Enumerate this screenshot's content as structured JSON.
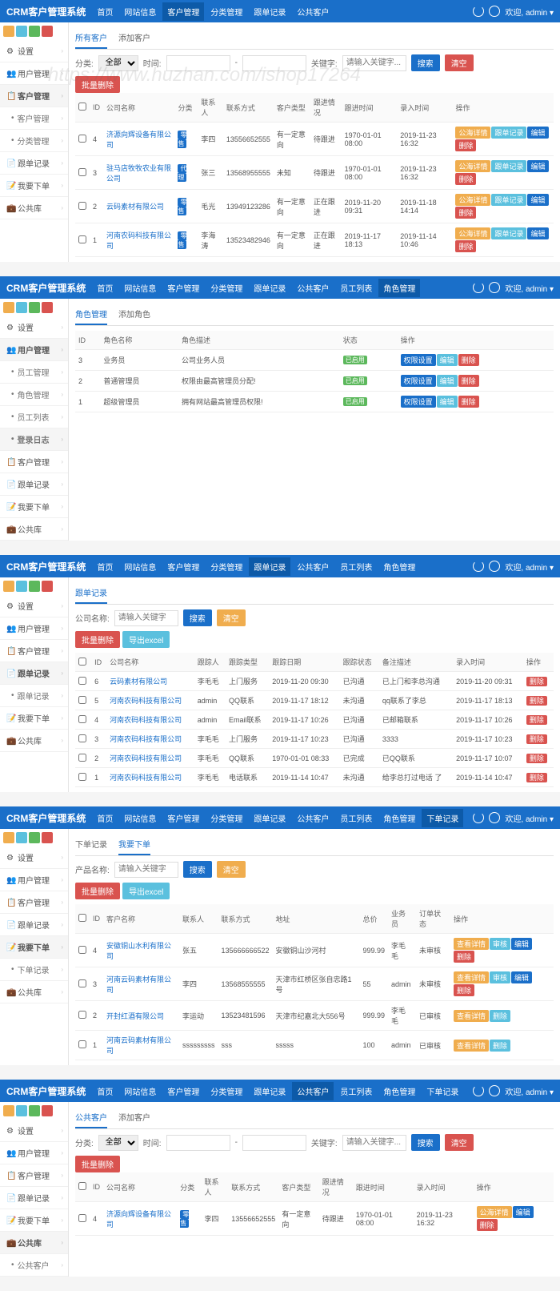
{
  "brand": "CRM客户管理系统",
  "welcome": "欢迎, admin",
  "watermark": "https://www.huzhan.com/ishop17264",
  "nav_items": [
    "首页",
    "网站信息",
    "客户管理",
    "分类管理",
    "跟单记录",
    "公共客户",
    "员工列表",
    "角色管理",
    "下单记录"
  ],
  "p1": {
    "nav_active": 2,
    "sidebar": [
      {
        "label": "设置",
        "icon": "⚙"
      },
      {
        "label": "用户管理",
        "icon": "👥"
      },
      {
        "label": "客户管理",
        "icon": "📋",
        "active": true
      },
      {
        "label": "客户管理",
        "sub": true
      },
      {
        "label": "分类管理",
        "sub": true
      },
      {
        "label": "跟单记录",
        "icon": "📄"
      },
      {
        "label": "我要下单",
        "icon": "📝"
      },
      {
        "label": "公共库",
        "icon": "💼"
      }
    ],
    "tabs": [
      "所有客户",
      "添加客户"
    ],
    "filters": {
      "cat": "分类:",
      "cat_all": "全部",
      "time": "时间:",
      "kw": "关键字:",
      "kw_ph": "请输入关键字...",
      "search": "搜索",
      "clear": "清空"
    },
    "batch_del": "批量删除",
    "cols": [
      "ID",
      "公司名称",
      "分类",
      "联系人",
      "联系方式",
      "客户类型",
      "跟进情况",
      "跟进时间",
      "录入时间",
      "操作"
    ],
    "rows": [
      {
        "id": "4",
        "co": "济源向辉设备有限公司",
        "cat": "零售",
        "contact": "李四",
        "phone": "13556652555",
        "type": "有一定意向",
        "follow": "待跟进",
        "ftime": "1970-01-01 08:00",
        "rtime": "2019-11-23 16:32"
      },
      {
        "id": "3",
        "co": "驻马店牧牧农业有限公司",
        "cat": "代理",
        "contact": "张三",
        "phone": "13568955555",
        "type": "未知",
        "follow": "待跟进",
        "ftime": "1970-01-01 08:00",
        "rtime": "2019-11-23 16:32"
      },
      {
        "id": "2",
        "co": "云码素材有限公司",
        "cat": "零售",
        "contact": "毛光",
        "phone": "13949123286",
        "type": "有一定意向",
        "follow": "正在跟进",
        "ftime": "2019-11-20 09:31",
        "rtime": "2019-11-18 14:14"
      },
      {
        "id": "1",
        "co": "河南农码科技有限公司",
        "cat": "零售",
        "contact": "李海涛",
        "phone": "13523482946",
        "type": "有一定意向",
        "follow": "正在跟进",
        "ftime": "2019-11-17 18:13",
        "rtime": "2019-11-14 10:46"
      }
    ],
    "ops": [
      "公海详情",
      "跟单记录",
      "编辑",
      "删除"
    ]
  },
  "p2": {
    "nav_active": 7,
    "sidebar": [
      {
        "label": "设置",
        "icon": "⚙"
      },
      {
        "label": "用户管理",
        "icon": "👥",
        "active": true
      },
      {
        "label": "员工管理",
        "sub": true
      },
      {
        "label": "角色管理",
        "sub": true
      },
      {
        "label": "员工列表",
        "sub": true
      },
      {
        "label": "登录日志",
        "sub": true,
        "active": true
      },
      {
        "label": "客户管理",
        "icon": "📋"
      },
      {
        "label": "跟单记录",
        "icon": "📄"
      },
      {
        "label": "我要下单",
        "icon": "📝"
      },
      {
        "label": "公共库",
        "icon": "💼"
      }
    ],
    "tabs": [
      "角色管理",
      "添加角色"
    ],
    "cols": [
      "ID",
      "角色名称",
      "角色描述",
      "状态",
      "操作"
    ],
    "rows": [
      {
        "id": "3",
        "name": "业务员",
        "desc": "公司业务人员",
        "status": "已启用"
      },
      {
        "id": "2",
        "name": "普通管理员",
        "desc": "权限由最高管理员分配!",
        "status": "已启用"
      },
      {
        "id": "1",
        "name": "超级管理员",
        "desc": "拥有网站最高管理员权限!",
        "status": "已启用"
      }
    ],
    "ops": [
      "权限设置",
      "编辑",
      "删除"
    ]
  },
  "p3": {
    "nav_active": 4,
    "sidebar": [
      {
        "label": "设置",
        "icon": "⚙"
      },
      {
        "label": "用户管理",
        "icon": "👥"
      },
      {
        "label": "客户管理",
        "icon": "📋"
      },
      {
        "label": "跟单记录",
        "icon": "📄",
        "active": true
      },
      {
        "label": "跟单记录",
        "sub": true
      },
      {
        "label": "我要下单",
        "icon": "📝"
      },
      {
        "label": "公共库",
        "icon": "💼"
      }
    ],
    "tabs": [
      "跟单记录"
    ],
    "search_label": "公司名称:",
    "search_ph": "请输入关键字",
    "btn_search": "搜索",
    "btn_clear": "清空",
    "batch_del": "批量删除",
    "export": "导出excel",
    "cols": [
      "ID",
      "公司名称",
      "跟踪人",
      "跟踪类型",
      "跟踪日期",
      "跟踪状态",
      "备注描述",
      "录入时间",
      "操作"
    ],
    "rows": [
      {
        "id": "6",
        "co": "云码素材有限公司",
        "person": "李毛毛",
        "type": "上门服务",
        "date": "2019-11-20 09:30",
        "status": "已沟通",
        "note": "已上门和李总沟通",
        "rtime": "2019-11-20 09:31"
      },
      {
        "id": "5",
        "co": "河南农码科技有限公司",
        "person": "admin",
        "type": "QQ联系",
        "date": "2019-11-17 18:12",
        "status": "未沟通",
        "note": "qq联系了李总",
        "rtime": "2019-11-17 18:13"
      },
      {
        "id": "4",
        "co": "河南农码科技有限公司",
        "person": "admin",
        "type": "Email联系",
        "date": "2019-11-17 10:26",
        "status": "已沟通",
        "note": "已邮箱联系",
        "rtime": "2019-11-17 10:26"
      },
      {
        "id": "3",
        "co": "河南农码科技有限公司",
        "person": "李毛毛",
        "type": "上门服务",
        "date": "2019-11-17 10:23",
        "status": "已沟通",
        "note": "3333",
        "rtime": "2019-11-17 10:23"
      },
      {
        "id": "2",
        "co": "河南农码科技有限公司",
        "person": "李毛毛",
        "type": "QQ联系",
        "date": "1970-01-01 08:33",
        "status": "已完成",
        "note": "已QQ联系",
        "rtime": "2019-11-17 10:07"
      },
      {
        "id": "1",
        "co": "河南农码科技有限公司",
        "person": "李毛毛",
        "type": "电话联系",
        "date": "2019-11-14 10:47",
        "status": "未沟通",
        "note": "给李总打过电话 了",
        "rtime": "2019-11-14 10:47"
      }
    ],
    "op_del": "删除"
  },
  "p4": {
    "nav_active": 8,
    "sidebar": [
      {
        "label": "设置",
        "icon": "⚙"
      },
      {
        "label": "用户管理",
        "icon": "👥"
      },
      {
        "label": "客户管理",
        "icon": "📋"
      },
      {
        "label": "跟单记录",
        "icon": "📄"
      },
      {
        "label": "我要下单",
        "icon": "📝",
        "active": true
      },
      {
        "label": "下单记录",
        "sub": true
      },
      {
        "label": "公共库",
        "icon": "💼"
      }
    ],
    "tabs": [
      "下单记录",
      "我要下单"
    ],
    "tab_active": 1,
    "search_label": "产品名称:",
    "search_ph": "请输入关键字",
    "btn_search": "搜索",
    "btn_clear": "清空",
    "batch_del": "批量删除",
    "export": "导出excel",
    "cols": [
      "ID",
      "客户名称",
      "联系人",
      "联系方式",
      "地址",
      "总价",
      "业务员",
      "订单状态",
      "操作"
    ],
    "rows": [
      {
        "id": "4",
        "co": "安徽铜山水利有限公司",
        "contact": "张五",
        "phone": "135666666522",
        "addr": "安徽铜山沙河村",
        "price": "999.99",
        "sales": "李毛毛",
        "status": "未审核",
        "ops": [
          "查看详情",
          "审核",
          "编辑",
          "删除"
        ]
      },
      {
        "id": "3",
        "co": "河南云码素材有限公司",
        "contact": "李四",
        "phone": "13568555555",
        "addr": "天津市红桥区张自忠路1号",
        "price": "55",
        "sales": "admin",
        "status": "未审核",
        "ops": [
          "查看详情",
          "审核",
          "编辑",
          "删除"
        ]
      },
      {
        "id": "2",
        "co": "开封红酒有限公司",
        "contact": "李运动",
        "phone": "13523481596",
        "addr": "天津市纪嘉北大556号",
        "price": "999.99",
        "sales": "李毛毛",
        "status": "已审核",
        "ops": [
          "查看详情",
          "删除"
        ]
      },
      {
        "id": "1",
        "co": "河南云码素材有限公司",
        "contact": "sssssssss",
        "phone": "sss",
        "addr": "sssss",
        "price": "100",
        "sales": "admin",
        "status": "已审核",
        "ops": [
          "查看详情",
          "删除"
        ]
      }
    ]
  },
  "p5": {
    "nav_active": 5,
    "sidebar": [
      {
        "label": "设置",
        "icon": "⚙"
      },
      {
        "label": "用户管理",
        "icon": "👥"
      },
      {
        "label": "客户管理",
        "icon": "📋"
      },
      {
        "label": "跟单记录",
        "icon": "📄"
      },
      {
        "label": "我要下单",
        "icon": "📝"
      },
      {
        "label": "公共库",
        "icon": "💼",
        "active": true
      },
      {
        "label": "公共客户",
        "sub": true
      }
    ],
    "tabs": [
      "公共客户",
      "添加客户"
    ],
    "filters": {
      "cat": "分类:",
      "cat_all": "全部",
      "time": "时间:",
      "kw": "关键字:",
      "kw_ph": "请输入关键字...",
      "search": "搜索",
      "clear": "清空"
    },
    "batch_del": "批量删除",
    "cols": [
      "ID",
      "公司名称",
      "分类",
      "联系人",
      "联系方式",
      "客户类型",
      "跟进情况",
      "跟进时间",
      "录入时间",
      "操作"
    ],
    "rows": [
      {
        "id": "4",
        "co": "济源向辉设备有限公司",
        "cat": "零售",
        "contact": "李四",
        "phone": "13556652555",
        "type": "有一定意向",
        "follow": "待跟进",
        "ftime": "1970-01-01 08:00",
        "rtime": "2019-11-23 16:32"
      }
    ],
    "ops": [
      "公海详情",
      "编辑",
      "删除"
    ]
  }
}
